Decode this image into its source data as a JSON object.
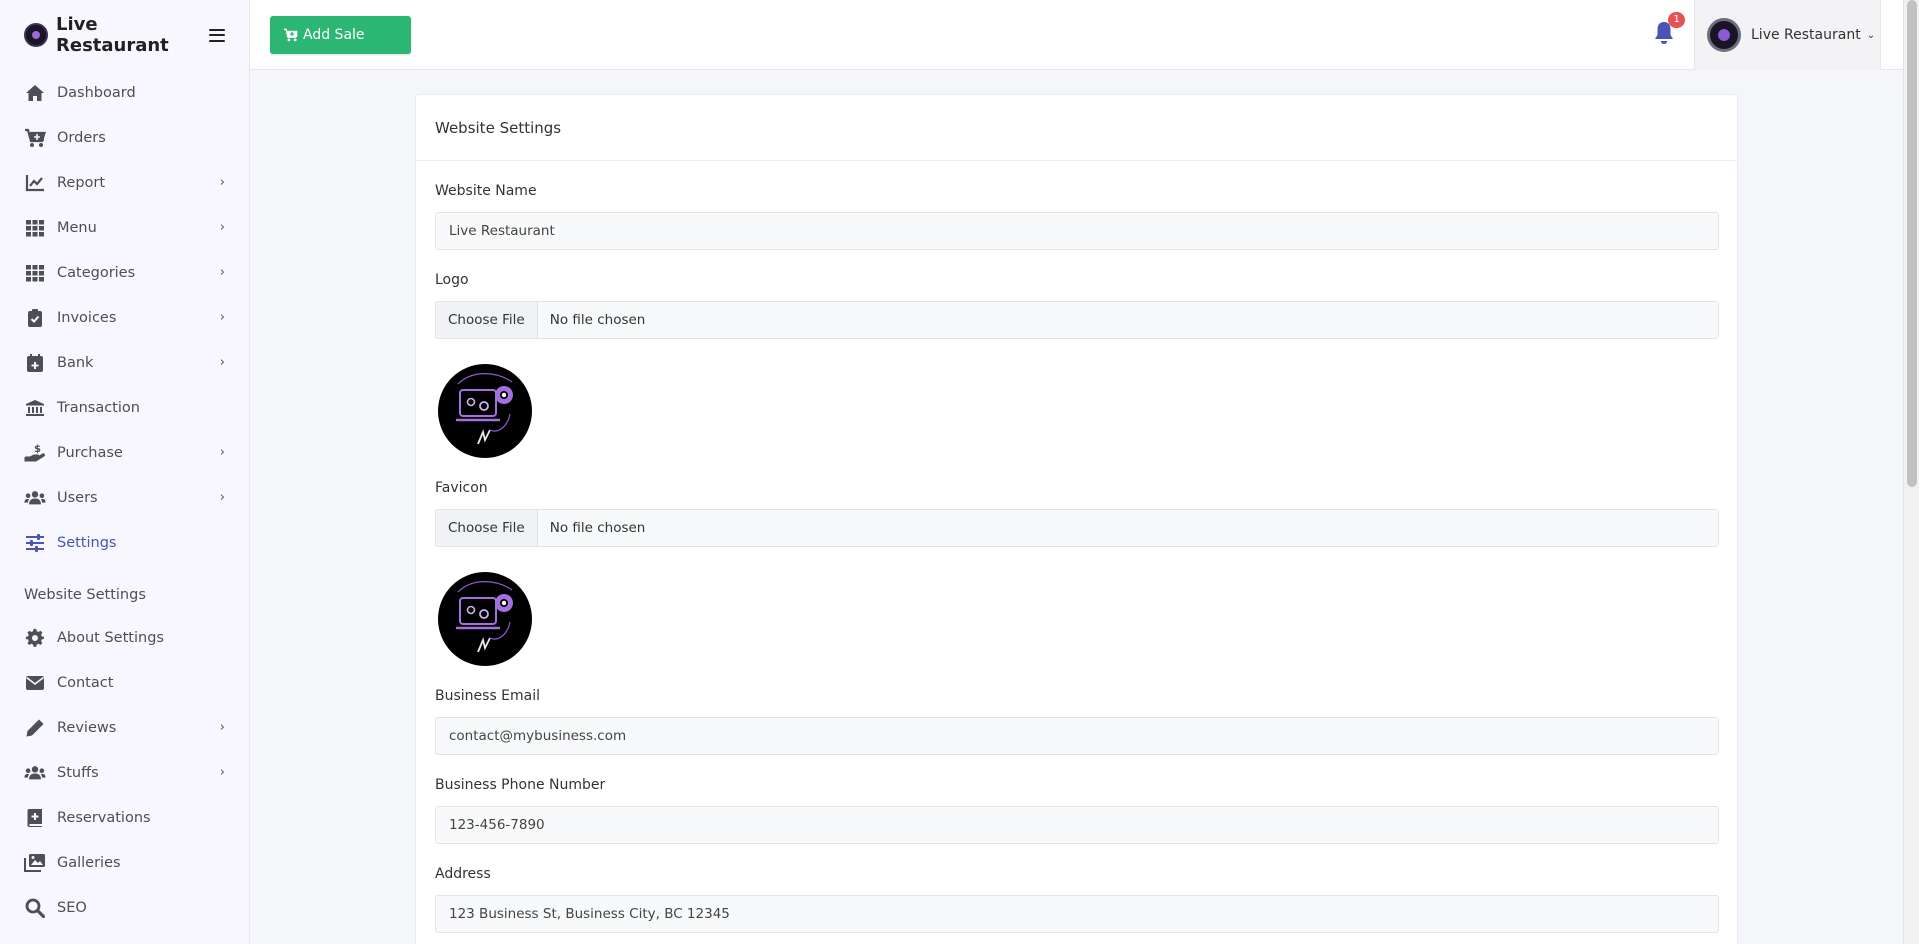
{
  "brand": {
    "name": "Live Restaurant"
  },
  "sidebar": {
    "items": [
      {
        "label": "Dashboard",
        "icon": "home-icon",
        "has_chevron": false
      },
      {
        "label": "Orders",
        "icon": "cart-icon",
        "has_chevron": false
      },
      {
        "label": "Report",
        "icon": "chart-line-icon",
        "has_chevron": true
      },
      {
        "label": "Menu",
        "icon": "grid-icon",
        "has_chevron": true
      },
      {
        "label": "Categories",
        "icon": "grid-icon",
        "has_chevron": true
      },
      {
        "label": "Invoices",
        "icon": "clipboard-check-icon",
        "has_chevron": true
      },
      {
        "label": "Bank",
        "icon": "calendar-plus-icon",
        "has_chevron": true
      },
      {
        "label": "Transaction",
        "icon": "bank-icon",
        "has_chevron": false
      },
      {
        "label": "Purchase",
        "icon": "hand-dollar-icon",
        "has_chevron": true
      },
      {
        "label": "Users",
        "icon": "users-icon",
        "has_chevron": true
      },
      {
        "label": "Settings",
        "icon": "sliders-icon",
        "has_chevron": false,
        "active": true
      }
    ],
    "section_title": "Website Settings",
    "website_items": [
      {
        "label": "About Settings",
        "icon": "gear-icon",
        "has_chevron": false
      },
      {
        "label": "Contact",
        "icon": "envelope-icon",
        "has_chevron": false
      },
      {
        "label": "Reviews",
        "icon": "pencil-icon",
        "has_chevron": true
      },
      {
        "label": "Stuffs",
        "icon": "users-icon",
        "has_chevron": true
      },
      {
        "label": "Reservations",
        "icon": "book-plus-icon",
        "has_chevron": false
      },
      {
        "label": "Galleries",
        "icon": "images-icon",
        "has_chevron": false
      },
      {
        "label": "SEO",
        "icon": "search-icon",
        "has_chevron": false
      }
    ]
  },
  "header": {
    "add_sale_label": "Add Sale",
    "notification_count": "1",
    "user_name": "Live Restaurant"
  },
  "card": {
    "title": "Website Settings",
    "website_name_label": "Website Name",
    "website_name_value": "Live Restaurant",
    "logo_label": "Logo",
    "favicon_label": "Favicon",
    "file_button": "Choose File",
    "file_none": "No file chosen",
    "business_email_label": "Business Email",
    "business_email_value": "contact@mybusiness.com",
    "business_phone_label": "Business Phone Number",
    "business_phone_value": "123-456-7890",
    "address_label": "Address",
    "address_value": "123 Business St, Business City, BC 12345"
  },
  "colors": {
    "accent": "#4a54b8",
    "add_sale": "#2bb673",
    "badge": "#e55353"
  }
}
